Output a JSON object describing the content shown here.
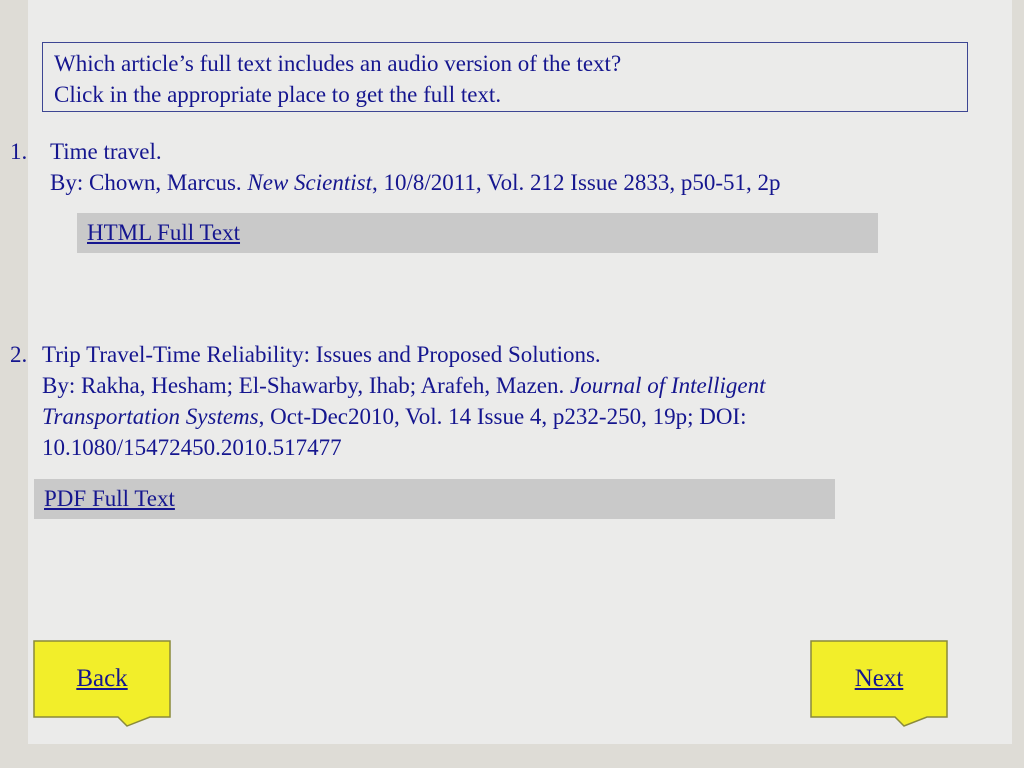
{
  "question": {
    "line1": "Which article’s full text includes an audio version of the text?",
    "line2": "Click in the appropriate place to get the full text."
  },
  "articles": [
    {
      "number": "1.",
      "title": "Time travel.",
      "byline_prefix": "By: Chown, Marcus. ",
      "journal": "New Scientist",
      "details": ", 10/8/2011, Vol. 212 Issue 2833, p50-51, 2p",
      "fulltext_link": "HTML Full Text"
    },
    {
      "number": "2.",
      "title": "Trip Travel-Time Reliability: Issues and Proposed Solutions.",
      "byline_prefix": "By: Rakha, Hesham; El-Shawarby, Ihab; Arafeh, Mazen. ",
      "journal_part1": "Journal of Intelligent",
      "journal_part2": "Transportation Systems",
      "details": ", Oct-Dec2010, Vol. 14 Issue 4, p232-250, 19p; DOI:",
      "doi": "10.1080/15472450.2010.517477",
      "fulltext_link": "PDF Full Text"
    }
  ],
  "nav": {
    "back_label": "Back",
    "next_label": "Next",
    "button_color": "#f2ee2a",
    "border_color": "#8a8a3a"
  },
  "colors": {
    "text": "#15168f",
    "link_bar": "#c9c9c9",
    "slide_bg": "#ebebea"
  }
}
